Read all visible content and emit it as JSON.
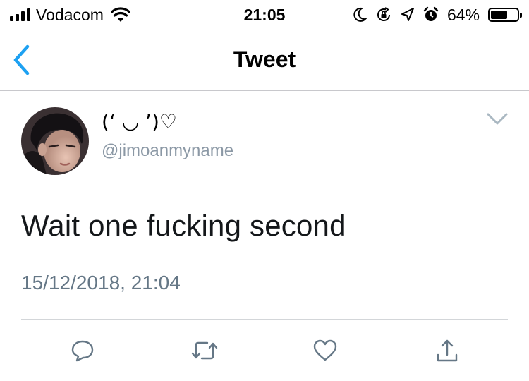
{
  "status_bar": {
    "carrier": "Vodacom",
    "time": "21:05",
    "battery_percent_label": "64%",
    "battery_level": 0.64,
    "icons": [
      "signal-icon",
      "wifi-icon",
      "moon-icon",
      "rotation-lock-icon",
      "location-icon",
      "alarm-icon",
      "battery-icon"
    ]
  },
  "nav": {
    "back_icon": "chevron-left-icon",
    "title": "Tweet"
  },
  "tweet": {
    "display_name": "(‘ ◡ ’)♡",
    "handle": "@jimoanmyname",
    "text": "Wait one fucking second",
    "timestamp": "15/12/2018, 21:04",
    "more_icon": "chevron-down-icon"
  },
  "actions": [
    {
      "icon": "reply-icon"
    },
    {
      "icon": "retweet-icon"
    },
    {
      "icon": "like-icon"
    },
    {
      "icon": "share-icon"
    }
  ],
  "colors": {
    "accent": "#1da1f2",
    "secondary_text": "#8b98a5",
    "icon_gray": "#657786",
    "divider": "#d3d6d9"
  }
}
